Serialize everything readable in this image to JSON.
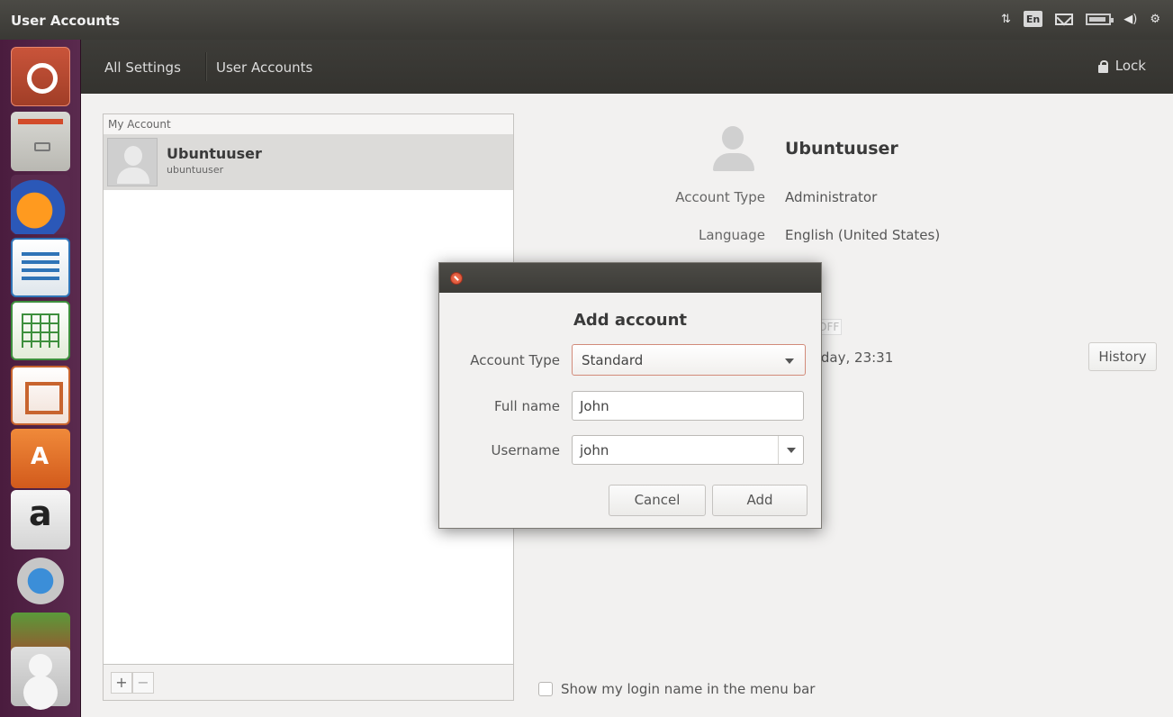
{
  "window": {
    "title": "User Accounts"
  },
  "panel": {
    "keyboard_indicator": "En",
    "network_glyph": "⇅",
    "volume_glyph": "◀)",
    "gear_glyph": "⚙"
  },
  "launcher": {
    "items": [
      "ubuntu-dash",
      "files",
      "firefox",
      "libreoffice-writer",
      "libreoffice-calc",
      "libreoffice-impress",
      "ubuntu-software",
      "amazon",
      "system-settings",
      "workspace-switcher",
      "user-accounts"
    ]
  },
  "header": {
    "crumb_all": "All Settings",
    "crumb_current": "User Accounts",
    "lock_label": "Lock"
  },
  "accounts": {
    "section_title": "My Account",
    "items": [
      {
        "full_name": "Ubuntuuser",
        "username": "ubuntuuser"
      }
    ],
    "add_symbol": "+",
    "remove_symbol": "−"
  },
  "details": {
    "name": "Ubuntuuser",
    "account_type_label": "Account Type",
    "account_type_value": "Administrator",
    "language_label": "Language",
    "language_value": "English (United States)",
    "auto_login_fragment": "OFF",
    "last_login_fragment": "rday, 23:31",
    "history_button": "History",
    "show_login_label": "Show my login name in the menu bar"
  },
  "dialog": {
    "title": "Add account",
    "account_type_label": "Account Type",
    "account_type_value": "Standard",
    "full_name_label": "Full name",
    "full_name_value": "John",
    "username_label": "Username",
    "username_value": "john",
    "cancel_label": "Cancel",
    "add_label": "Add"
  }
}
